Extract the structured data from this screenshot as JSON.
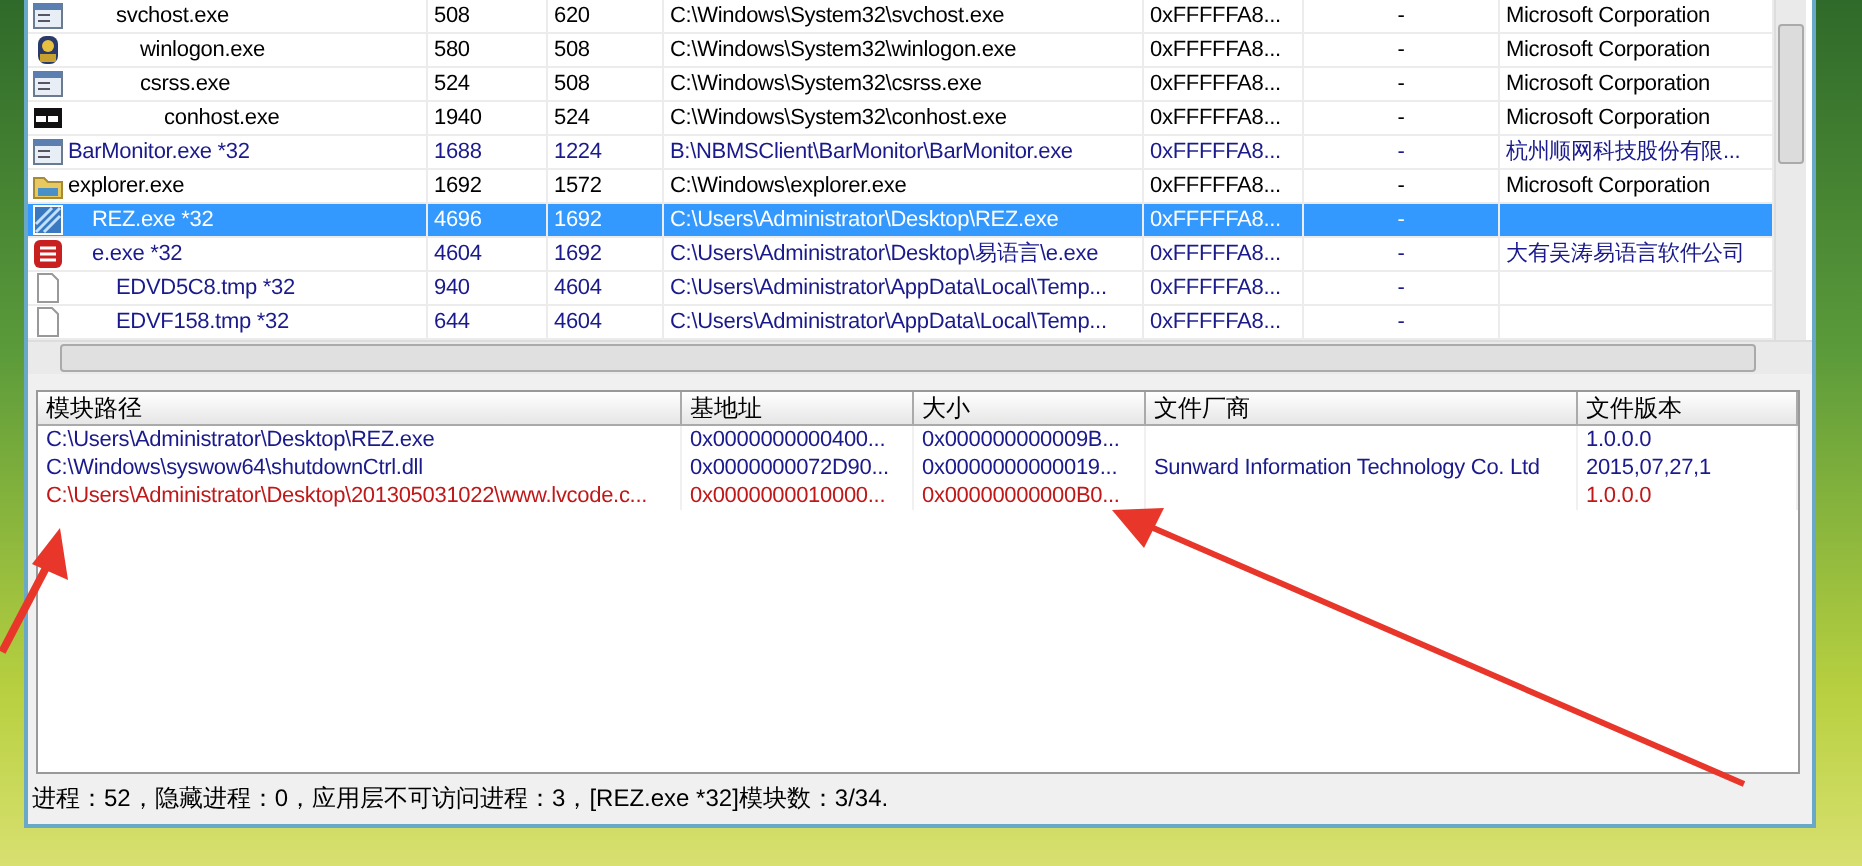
{
  "process_list": {
    "clipped_branch": [
      {
        "kind": "app",
        "name": "svchost.exe",
        "pid": "508",
        "ppid": "620",
        "path": "C:\\Windows\\System32\\svchost.exe",
        "eprocess": "0xFFFFFA8...",
        "column_6": "-",
        "company": "Microsoft Corporation",
        "color": "#000000",
        "selected": false,
        "children": [
          {
            "kind": "logon",
            "name": "winlogon.exe",
            "pid": "580",
            "ppid": "508",
            "path": "C:\\Windows\\System32\\winlogon.exe",
            "eprocess": "0xFFFFFA8...",
            "column_6": "-",
            "company": "Microsoft Corporation",
            "color": "#000000",
            "selected": false
          },
          {
            "kind": "app",
            "name": "csrss.exe",
            "pid": "524",
            "ppid": "508",
            "path": "C:\\Windows\\System32\\csrss.exe",
            "eprocess": "0xFFFFFA8...",
            "column_6": "-",
            "company": "Microsoft Corporation",
            "color": "#000000",
            "selected": false,
            "children": [
              {
                "kind": "console",
                "name": "conhost.exe",
                "pid": "1940",
                "ppid": "524",
                "path": "C:\\Windows\\System32\\conhost.exe",
                "eprocess": "0xFFFFFA8...",
                "column_6": "-",
                "company": "Microsoft Corporation",
                "color": "#000000",
                "selected": false
              }
            ]
          }
        ]
      }
    ],
    "rows": [
      {
        "kind": "app",
        "name": "BarMonitor.exe *32",
        "pid": "1688",
        "ppid": "1224",
        "path": "B:\\NBMSClient\\BarMonitor\\BarMonitor.exe",
        "eprocess": "0xFFFFFA8...",
        "column_6": "-",
        "company": "杭州顺网科技股份有限...",
        "color": "#1a1a8c",
        "selected": false
      },
      {
        "kind": "folder",
        "name": "explorer.exe",
        "pid": "1692",
        "ppid": "1572",
        "path": "C:\\Windows\\explorer.exe",
        "eprocess": "0xFFFFFA8...",
        "column_6": "-",
        "company": "Microsoft Corporation",
        "color": "#000000",
        "selected": false,
        "children": [
          {
            "kind": "rez",
            "name": "REZ.exe *32",
            "pid": "4696",
            "ppid": "1692",
            "path": "C:\\Users\\Administrator\\Desktop\\REZ.exe",
            "eprocess": "0xFFFFFA8...",
            "column_6": "-",
            "selected": true
          },
          {
            "kind": "e",
            "name": "e.exe *32",
            "pid": "4604",
            "ppid": "1692",
            "path": "C:\\Users\\Administrator\\Desktop\\易语言\\e.exe",
            "eprocess": "0xFFFFFA8...",
            "column_6": "-",
            "company": "大有吴涛易语言软件公司",
            "color": "#1a1a8c",
            "selected": false,
            "children": [
              {
                "kind": "blank",
                "name": "EDVD5C8.tmp *32",
                "pid": "940",
                "ppid": "4604",
                "path": "C:\\Users\\Administrator\\AppData\\Local\\Temp...",
                "eprocess": "0xFFFFFA8...",
                "column_6": "-",
                "color": "#1a1a8c",
                "selected": false
              },
              {
                "kind": "blank",
                "name": "EDVF158.tmp *32",
                "pid": "644",
                "ppid": "4604",
                "path": "C:\\Users\\Administrator\\AppData\\Local\\Temp...",
                "eprocess": "0xFFFFFA8...",
                "column_6": "-",
                "color": "#1a1a8c",
                "selected": false
              }
            ]
          }
        ]
      }
    ]
  },
  "module_list": {
    "columns": [
      "模块路径",
      "基地址",
      "大小",
      "文件厂商",
      "文件版本"
    ],
    "rows": [
      {
        "color": "#1a1a8c",
        "cells": [
          "C:\\Users\\Administrator\\Desktop\\REZ.exe",
          "0x0000000000400...",
          "0x000000000009B...",
          "",
          "1.0.0.0"
        ]
      },
      {
        "color": "#1a1a8c",
        "cells": [
          "C:\\Windows\\syswow64\\shutdownCtrl.dll",
          "0x0000000072D90...",
          "0x0000000000019...",
          "Sunward Information Technology Co. Ltd",
          "2015,07,27,1"
        ]
      },
      {
        "color": "#c01818",
        "cells": [
          "C:\\Users\\Administrator\\Desktop\\201305031022\\www.lvcode.c...",
          "0x0000000010000...",
          "0x00000000000B0...",
          "",
          "1.0.0.0"
        ]
      }
    ]
  },
  "status_bar": "进程：52，隐藏进程：0，应用层不可访问进程：3，[REZ.exe *32]模块数：3/34."
}
